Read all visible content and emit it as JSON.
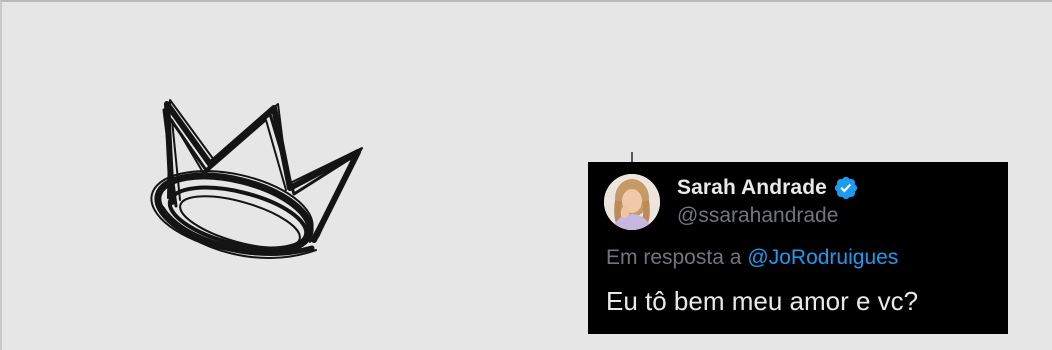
{
  "decoration": {
    "icon": "crown-icon"
  },
  "tweet": {
    "display_name": "Sarah Andrade",
    "verified_icon": "verified-badge-icon",
    "handle": "@ssarahandrade",
    "reply_prefix": "Em resposta a",
    "reply_to": "@JoRodruigues",
    "text": "Eu tô bem meu amor e vc?"
  },
  "colors": {
    "background": "#e6e6e6",
    "card": "#000000",
    "accent": "#1d9bf0",
    "name": "#e7e9ea",
    "muted": "#71767b"
  }
}
